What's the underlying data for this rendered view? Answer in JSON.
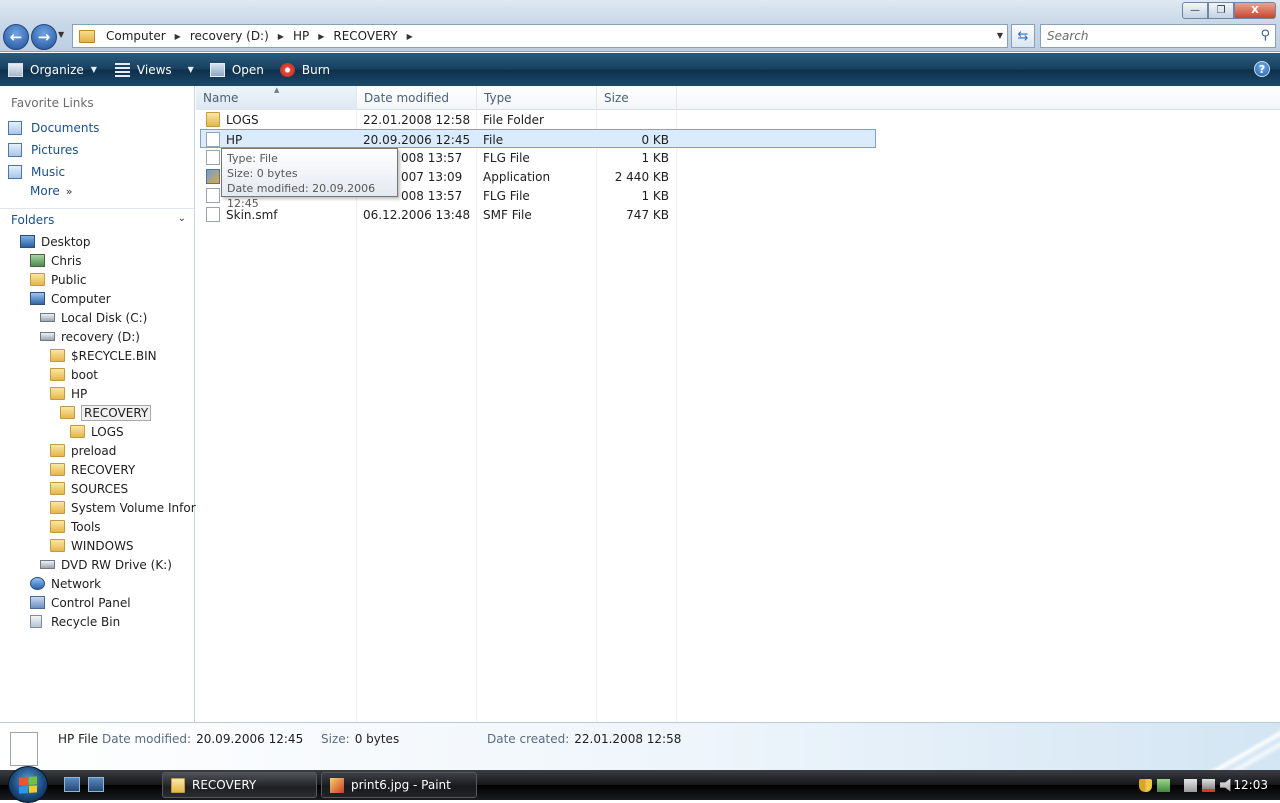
{
  "window": {
    "buttons": {
      "minimize": "—",
      "maximize": "❐",
      "close": "X"
    }
  },
  "nav": {
    "back": "←",
    "forward": "→"
  },
  "address": {
    "crumbs": [
      "Computer",
      "recovery (D:)",
      "HP",
      "RECOVERY"
    ]
  },
  "search": {
    "placeholder": "Search"
  },
  "commands": {
    "organize": "Organize",
    "views": "Views",
    "open": "Open",
    "burn": "Burn",
    "help": "?"
  },
  "navpane": {
    "favorites_title": "Favorite Links",
    "favorites": [
      "Documents",
      "Pictures",
      "Music"
    ],
    "more": "More",
    "folders_title": "Folders",
    "tree": [
      {
        "label": "Desktop",
        "icon": "desktop-icon"
      },
      {
        "label": "Chris",
        "icon": "user-folder-icon"
      },
      {
        "label": "Public",
        "icon": "folder-icon"
      },
      {
        "label": "Computer",
        "icon": "computer-icon"
      },
      {
        "label": "Local Disk (C:)",
        "icon": "drive-icon"
      },
      {
        "label": "recovery (D:)",
        "icon": "drive-icon"
      },
      {
        "label": "$RECYCLE.BIN",
        "icon": "folder-icon"
      },
      {
        "label": "boot",
        "icon": "folder-icon"
      },
      {
        "label": "HP",
        "icon": "folder-icon"
      },
      {
        "label": "RECOVERY",
        "icon": "folder-icon",
        "selected": true
      },
      {
        "label": "LOGS",
        "icon": "folder-icon"
      },
      {
        "label": "preload",
        "icon": "folder-icon"
      },
      {
        "label": "RECOVERY",
        "icon": "folder-icon"
      },
      {
        "label": "SOURCES",
        "icon": "folder-icon"
      },
      {
        "label": "System Volume Inform",
        "icon": "folder-icon"
      },
      {
        "label": "Tools",
        "icon": "folder-icon"
      },
      {
        "label": "WINDOWS",
        "icon": "folder-icon"
      },
      {
        "label": "DVD RW Drive (K:)",
        "icon": "dvd-drive-icon"
      },
      {
        "label": "Network",
        "icon": "network-icon"
      },
      {
        "label": "Control Panel",
        "icon": "control-panel-icon"
      },
      {
        "label": "Recycle Bin",
        "icon": "recycle-bin-icon"
      }
    ]
  },
  "filelist": {
    "columns": [
      "Name",
      "Date modified",
      "Type",
      "Size"
    ],
    "sorted_column": "Name",
    "rows": [
      {
        "name": "LOGS",
        "date": "22.01.2008 12:58",
        "type": "File Folder",
        "size": "",
        "icon": "folder-icon"
      },
      {
        "name": "HP",
        "date": "20.09.2006 12:45",
        "type": "File",
        "size": "0 KB",
        "icon": "file-icon",
        "selected": true
      },
      {
        "name": "",
        "date": "008 13:57",
        "type": "FLG File",
        "size": "1 KB",
        "icon": "file-icon"
      },
      {
        "name": "",
        "date": "007 13:09",
        "type": "Application",
        "size": "2 440 KB",
        "icon": "app-icon"
      },
      {
        "name": "",
        "date": "008 13:57",
        "type": "FLG File",
        "size": "1 KB",
        "icon": "file-icon"
      },
      {
        "name": "Skin.smf",
        "date": "06.12.2006 13:48",
        "type": "SMF File",
        "size": "747 KB",
        "icon": "file-icon"
      }
    ]
  },
  "tooltip": {
    "type": "Type: File",
    "size": "Size: 0 bytes",
    "date": "Date modified: 20.09.2006 12:45"
  },
  "details": {
    "name": "HP",
    "kind": "File",
    "modified_label": "Date modified:",
    "modified": "20.09.2006 12:45",
    "size_label": "Size:",
    "size": "0 bytes",
    "created_label": "Date created:",
    "created": "22.01.2008 12:58"
  },
  "taskbar": {
    "tasks": [
      {
        "label": "RECOVERY",
        "active": true
      },
      {
        "label": "print6.jpg - Paint",
        "active": false
      }
    ],
    "clock": "12:03"
  }
}
